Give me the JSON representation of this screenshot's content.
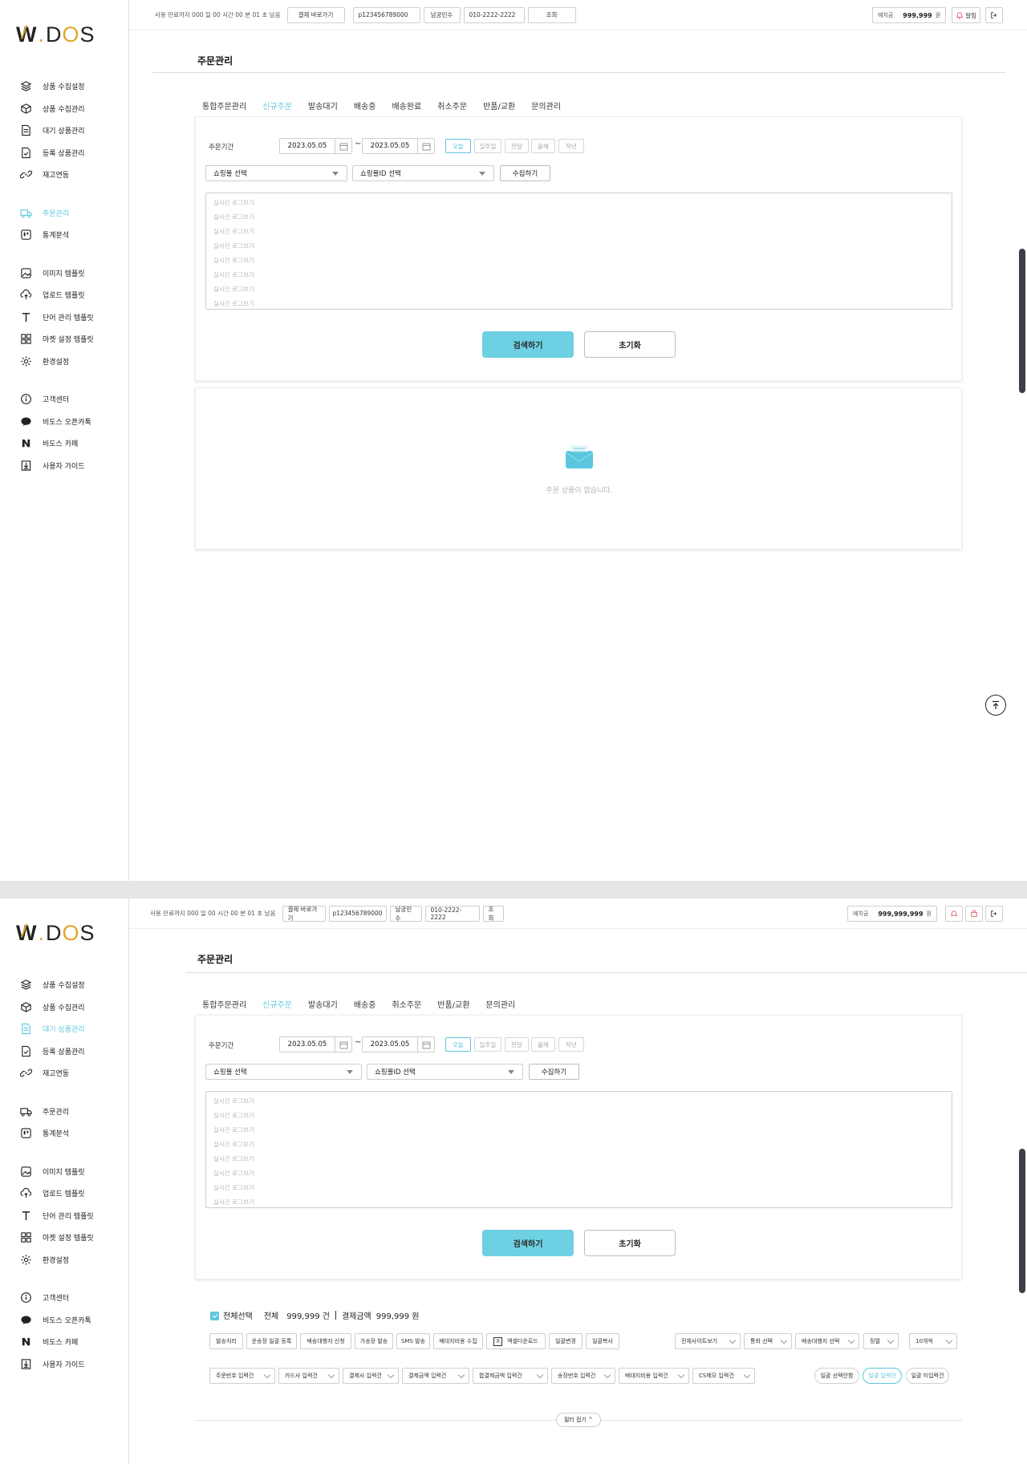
{
  "app": {
    "logo_prefix": "W",
    "logo_sep": ".",
    "logo_suffix_d": "D",
    "logo_suffix_o": "O",
    "logo_suffix_s": "S"
  },
  "topbar": {
    "remaining": "사용 만료까지 000 일 00 시간 00 분 01 초 남음",
    "pay_button": "결제 바로가기",
    "user_id": "p123456789000",
    "user_name": "남궁민수",
    "phone": "010-2222-2222",
    "lookup": "조회",
    "deposit_label": "예치금",
    "deposit_value_1": "999,999",
    "deposit_value_2": "999,999,999",
    "deposit_unit": "원",
    "alarm_label": "알림"
  },
  "sidebar": {
    "groups": [
      [
        {
          "label": "상품 수집설정",
          "icon": "layers-icon"
        },
        {
          "label": "상품 수집관리",
          "icon": "box-icon"
        },
        {
          "label": "대기 상품관리",
          "icon": "document-icon"
        },
        {
          "label": "등록 상품관리",
          "icon": "document-check-icon"
        },
        {
          "label": "재고연동",
          "icon": "link-icon"
        }
      ],
      [
        {
          "label": "주문관리",
          "icon": "truck-icon"
        },
        {
          "label": "통계분석",
          "icon": "chart-icon"
        }
      ],
      [
        {
          "label": "이미지 템플릿",
          "icon": "image-icon"
        },
        {
          "label": "업로드 템플릿",
          "icon": "upload-icon"
        },
        {
          "label": "단어 관리 템플릿",
          "icon": "text-icon"
        },
        {
          "label": "마켓 설정 템플릿",
          "icon": "grid-icon"
        },
        {
          "label": "환경설정",
          "icon": "gear-icon"
        }
      ],
      [
        {
          "label": "고객센터",
          "icon": "info-icon"
        },
        {
          "label": "비도스 오픈카톡",
          "icon": "talk-icon"
        },
        {
          "label": "비도스 카페",
          "icon": "naver-icon"
        },
        {
          "label": "사용자 가이드",
          "icon": "download-icon"
        }
      ]
    ]
  },
  "page": {
    "title": "주문관리"
  },
  "tabs": [
    "통합주문관리",
    "신규주문",
    "발송대기",
    "배송중",
    "배송완료",
    "취소주문",
    "반품/교환",
    "문의관리"
  ],
  "tabs2": [
    "통합주문관리",
    "신규주문",
    "발송대기",
    "배송중",
    "취소주문",
    "반품/교환",
    "문의관리"
  ],
  "filter": {
    "period_label": "주문기간",
    "date_from": "2023.05.05",
    "date_to": "2023.05.05",
    "tilde": "~",
    "quick": [
      "오늘",
      "일주일",
      "한달",
      "올해",
      "작년"
    ],
    "mall_select": "쇼핑몰 선택",
    "mall_id_select": "쇼핑몰ID 선택",
    "collect_button": "수집하기",
    "log_line": "실시간 로그보기",
    "search_button": "검색하기",
    "reset_button": "초기화"
  },
  "empty": {
    "message": "주문 상품이 없습니다."
  },
  "result": {
    "select_all": "전체선택",
    "total_label": "전체",
    "total_count": "999,999 건",
    "amount_label": "결제금액",
    "amount_value": "999,999 원",
    "actions": [
      "발송처리",
      "운송장 일괄 등록",
      "배송대행지 신청",
      "가송장 발송",
      "SMS 발송",
      "배대지비용 수집",
      "엑셀다운로드",
      "일괄변경",
      "일괄복사"
    ],
    "right_selects": [
      "전체사이트보기",
      "통화 선택",
      "배송대행지 선택",
      "정렬",
      "10개씩"
    ],
    "inputs": [
      "주문번호 입력건",
      "카드사 입력건",
      "결제사 입력건",
      "결제금액 입력건",
      "합결제금액 입력건",
      "송장번호 입력건",
      "배대지비용 입력건",
      "CS메모 입력건"
    ],
    "pills": [
      "일괄 선택안함",
      "일괄 입력건",
      "일괄 미입력건"
    ],
    "fold": "필터 접기 ^"
  }
}
